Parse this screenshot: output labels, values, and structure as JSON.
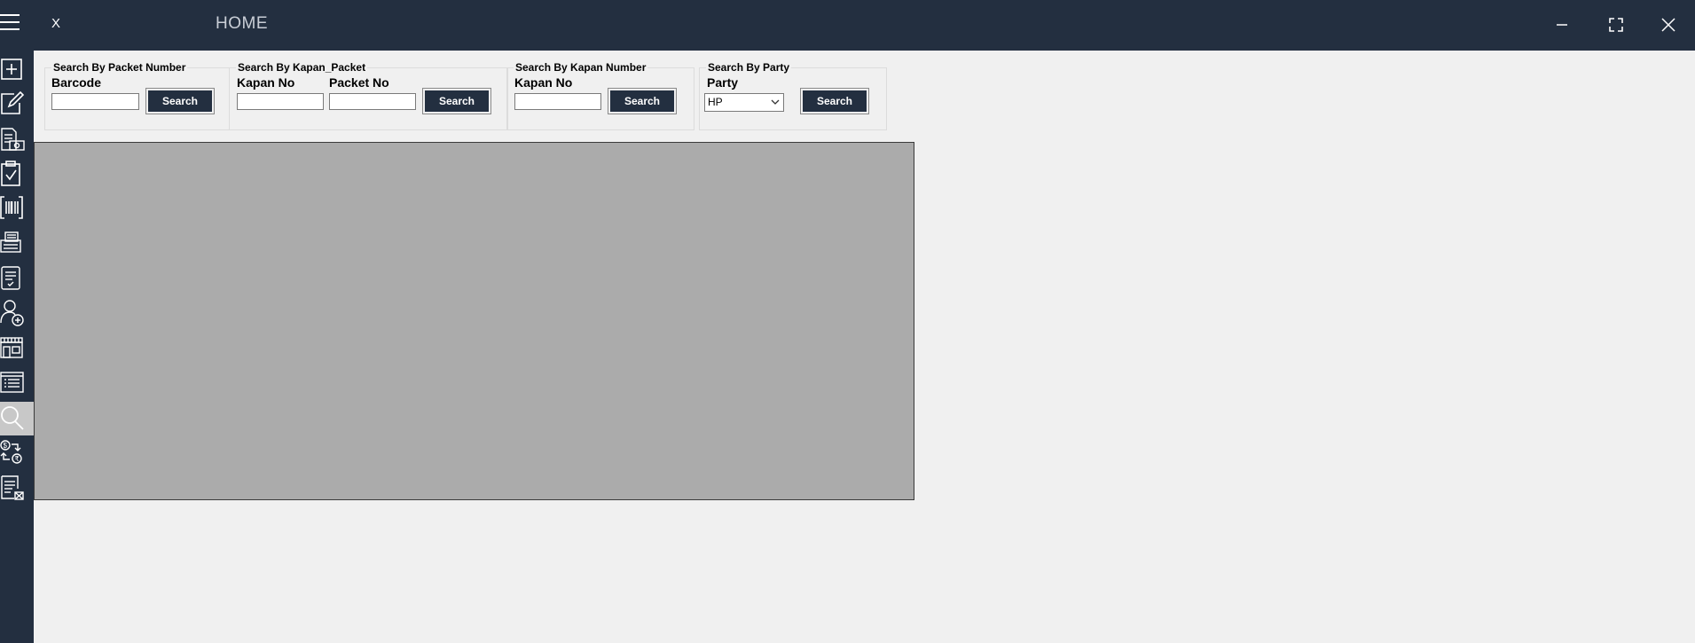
{
  "titlebar": {
    "close_x": "X",
    "title": "HOME",
    "minimize_icon": "minimize-icon",
    "maximize_icon": "maximize-icon",
    "close_icon": "close-icon"
  },
  "sidebar": {
    "active_index": 10,
    "items": [
      {
        "icon": "add-icon"
      },
      {
        "icon": "edit-icon"
      },
      {
        "icon": "invoice-money-icon"
      },
      {
        "icon": "clipboard-check-icon"
      },
      {
        "icon": "barcode-icon"
      },
      {
        "icon": "printer-icon"
      },
      {
        "icon": "document-check-icon"
      },
      {
        "icon": "add-user-icon"
      },
      {
        "icon": "store-icon"
      },
      {
        "icon": "list-icon"
      },
      {
        "icon": "search-icon"
      },
      {
        "icon": "exchange-icon"
      },
      {
        "icon": "report-icon"
      }
    ]
  },
  "packet_search": {
    "title": "Search By Packet Number",
    "barcode_label": "Barcode",
    "barcode_value": "",
    "search_label": "Search"
  },
  "kapan_packet_search": {
    "title": "Search By Kapan_Packet",
    "kapan_label": "Kapan No",
    "kapan_value": "",
    "packet_label": "Packet No",
    "packet_value": "",
    "search_label": "Search"
  },
  "kapan_search": {
    "title": "Search By Kapan Number",
    "kapan_label": "Kapan No",
    "kapan_value": "",
    "search_label": "Search"
  },
  "party_search": {
    "title": "Search By Party",
    "party_label": "Party",
    "party_value": "HP",
    "search_label": "Search"
  },
  "colors": {
    "sidebar_bg": "#232f40",
    "button_bg": "#232f40",
    "grid_bg": "#ababab",
    "page_bg": "#f0f0f0"
  }
}
